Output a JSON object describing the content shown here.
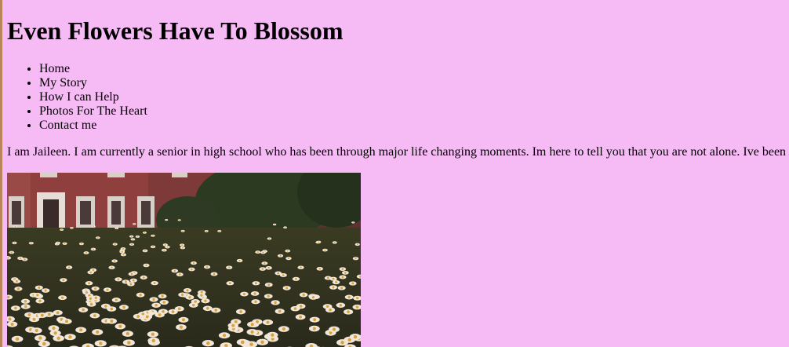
{
  "header": {
    "title": "Even Flowers Have To Blossom"
  },
  "nav": {
    "items": [
      {
        "label": "Home"
      },
      {
        "label": "My Story"
      },
      {
        "label": "How I can Help"
      },
      {
        "label": "Photos For The Heart"
      },
      {
        "label": "Contact me"
      }
    ]
  },
  "main": {
    "intro_text": "I am Jaileen. I am currently a senior in high school who has been through major life changing moments. Im here to tell you that you are not alone. Ive been"
  },
  "colors": {
    "background": "#f6baf5",
    "text": "#000000"
  }
}
